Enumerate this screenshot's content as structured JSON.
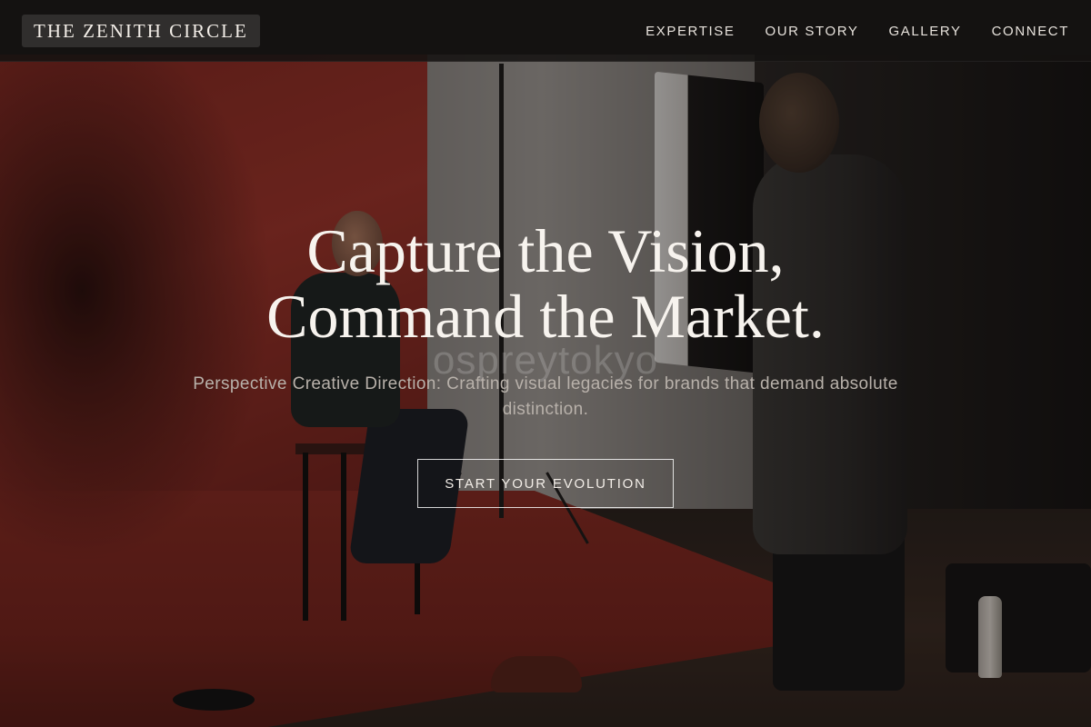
{
  "header": {
    "brand": "THE ZENITH CIRCLE",
    "nav": [
      {
        "label": "EXPERTISE"
      },
      {
        "label": "OUR STORY"
      },
      {
        "label": "GALLERY"
      },
      {
        "label": "CONNECT"
      }
    ]
  },
  "hero": {
    "title_line1": "Capture the Vision,",
    "title_line2": "Command the Market.",
    "subtitle": "Perspective Creative Direction: Crafting visual legacies for brands that demand absolute distinction.",
    "cta_label": "START YOUR EVOLUTION",
    "watermark": "ospreytokyo"
  },
  "colors": {
    "text_light": "#f7f3ee",
    "subtitle": "#b8b1aa",
    "backdrop_red": "#a3342a",
    "header_bg": "#141211"
  }
}
